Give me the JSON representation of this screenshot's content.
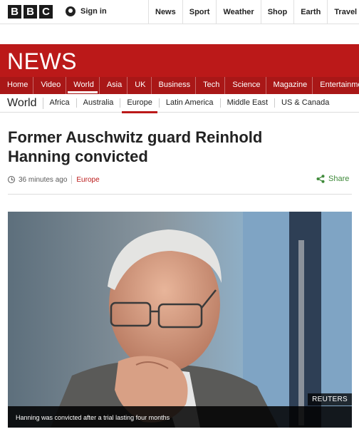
{
  "top_bar": {
    "logo_letters": [
      "B",
      "B",
      "C"
    ],
    "signin_label": "Sign in",
    "nav": [
      "News",
      "Sport",
      "Weather",
      "Shop",
      "Earth",
      "Travel"
    ]
  },
  "news_banner": {
    "title": "NEWS",
    "color": "#bb1919"
  },
  "section_nav": {
    "items": [
      "Home",
      "Video",
      "World",
      "Asia",
      "UK",
      "Business",
      "Tech",
      "Science",
      "Magazine",
      "Entertainment"
    ],
    "active": "World"
  },
  "sub_nav": {
    "title": "World",
    "items": [
      "Africa",
      "Australia",
      "Europe",
      "Latin America",
      "Middle East",
      "US & Canada"
    ],
    "active": "Europe"
  },
  "article": {
    "headline": "Former Auschwitz guard Reinhold Hanning convicted",
    "timestamp": "36 minutes ago",
    "category": "Europe",
    "share_label": "Share",
    "image_credit": "REUTERS",
    "image_caption": "Hanning was convicted after a trial lasting four months"
  }
}
